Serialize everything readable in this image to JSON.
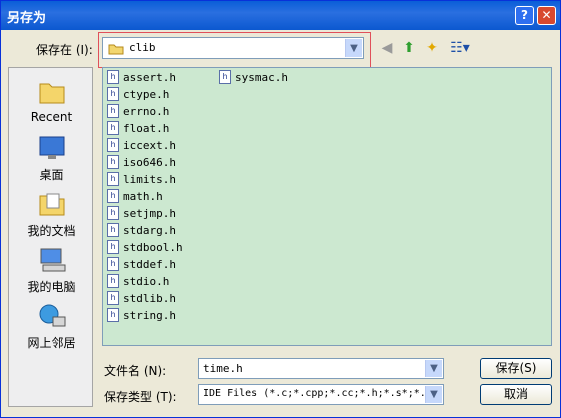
{
  "window": {
    "title": "另存为",
    "help_label": "?",
    "close_label": "✕"
  },
  "save_in": {
    "label": "保存在 (I):",
    "value": "clib"
  },
  "places": [
    {
      "label": "Recent"
    },
    {
      "label": "桌面"
    },
    {
      "label": "我的文档"
    },
    {
      "label": "我的电脑"
    },
    {
      "label": "网上邻居"
    }
  ],
  "files_col1": [
    "assert.h",
    "ctype.h",
    "errno.h",
    "float.h",
    "iccext.h",
    "iso646.h",
    "limits.h",
    "math.h",
    "setjmp.h",
    "stdarg.h",
    "stdbool.h",
    "stddef.h",
    "stdio.h",
    "stdlib.h",
    "string.h"
  ],
  "files_col2": [
    "sysmac.h"
  ],
  "file_icon": "h",
  "filename": {
    "label": "文件名 (N):",
    "value": "time.h"
  },
  "filetype": {
    "label": "保存类型 (T):",
    "value": "IDE Files (*.c;*.cpp;*.cc;*.h;*.s*;*."
  },
  "buttons": {
    "save": "保存(S)",
    "cancel": "取消"
  }
}
